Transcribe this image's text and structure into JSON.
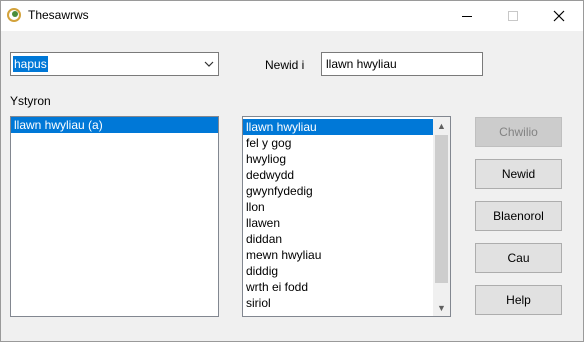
{
  "window": {
    "title": "Thesawrws",
    "minimize_label": "Minimize",
    "maximize_label": "Maximize",
    "close_label": "Close"
  },
  "lookup": {
    "word": "hapus"
  },
  "replace": {
    "label": "Newid i",
    "value": "llawn hwyliau"
  },
  "meanings": {
    "label": "Ystyron",
    "items": [
      "llawn hwyliau (a)"
    ],
    "selected_index": 0
  },
  "synonyms": {
    "items": [
      "llawn hwyliau",
      "fel y gog",
      "hwyliog",
      "dedwydd",
      "gwynfydedig",
      "llon",
      "llawen",
      "diddan",
      "mewn hwyliau",
      "diddig",
      "wrth ei fodd",
      "siriol"
    ],
    "selected_index": 0
  },
  "buttons": {
    "lookup": "Chwilio",
    "replace": "Newid",
    "previous": "Blaenorol",
    "cancel": "Cau",
    "help": "Help"
  },
  "colors": {
    "selection": "#0078d7",
    "dialog_bg": "#f0f0f0"
  }
}
